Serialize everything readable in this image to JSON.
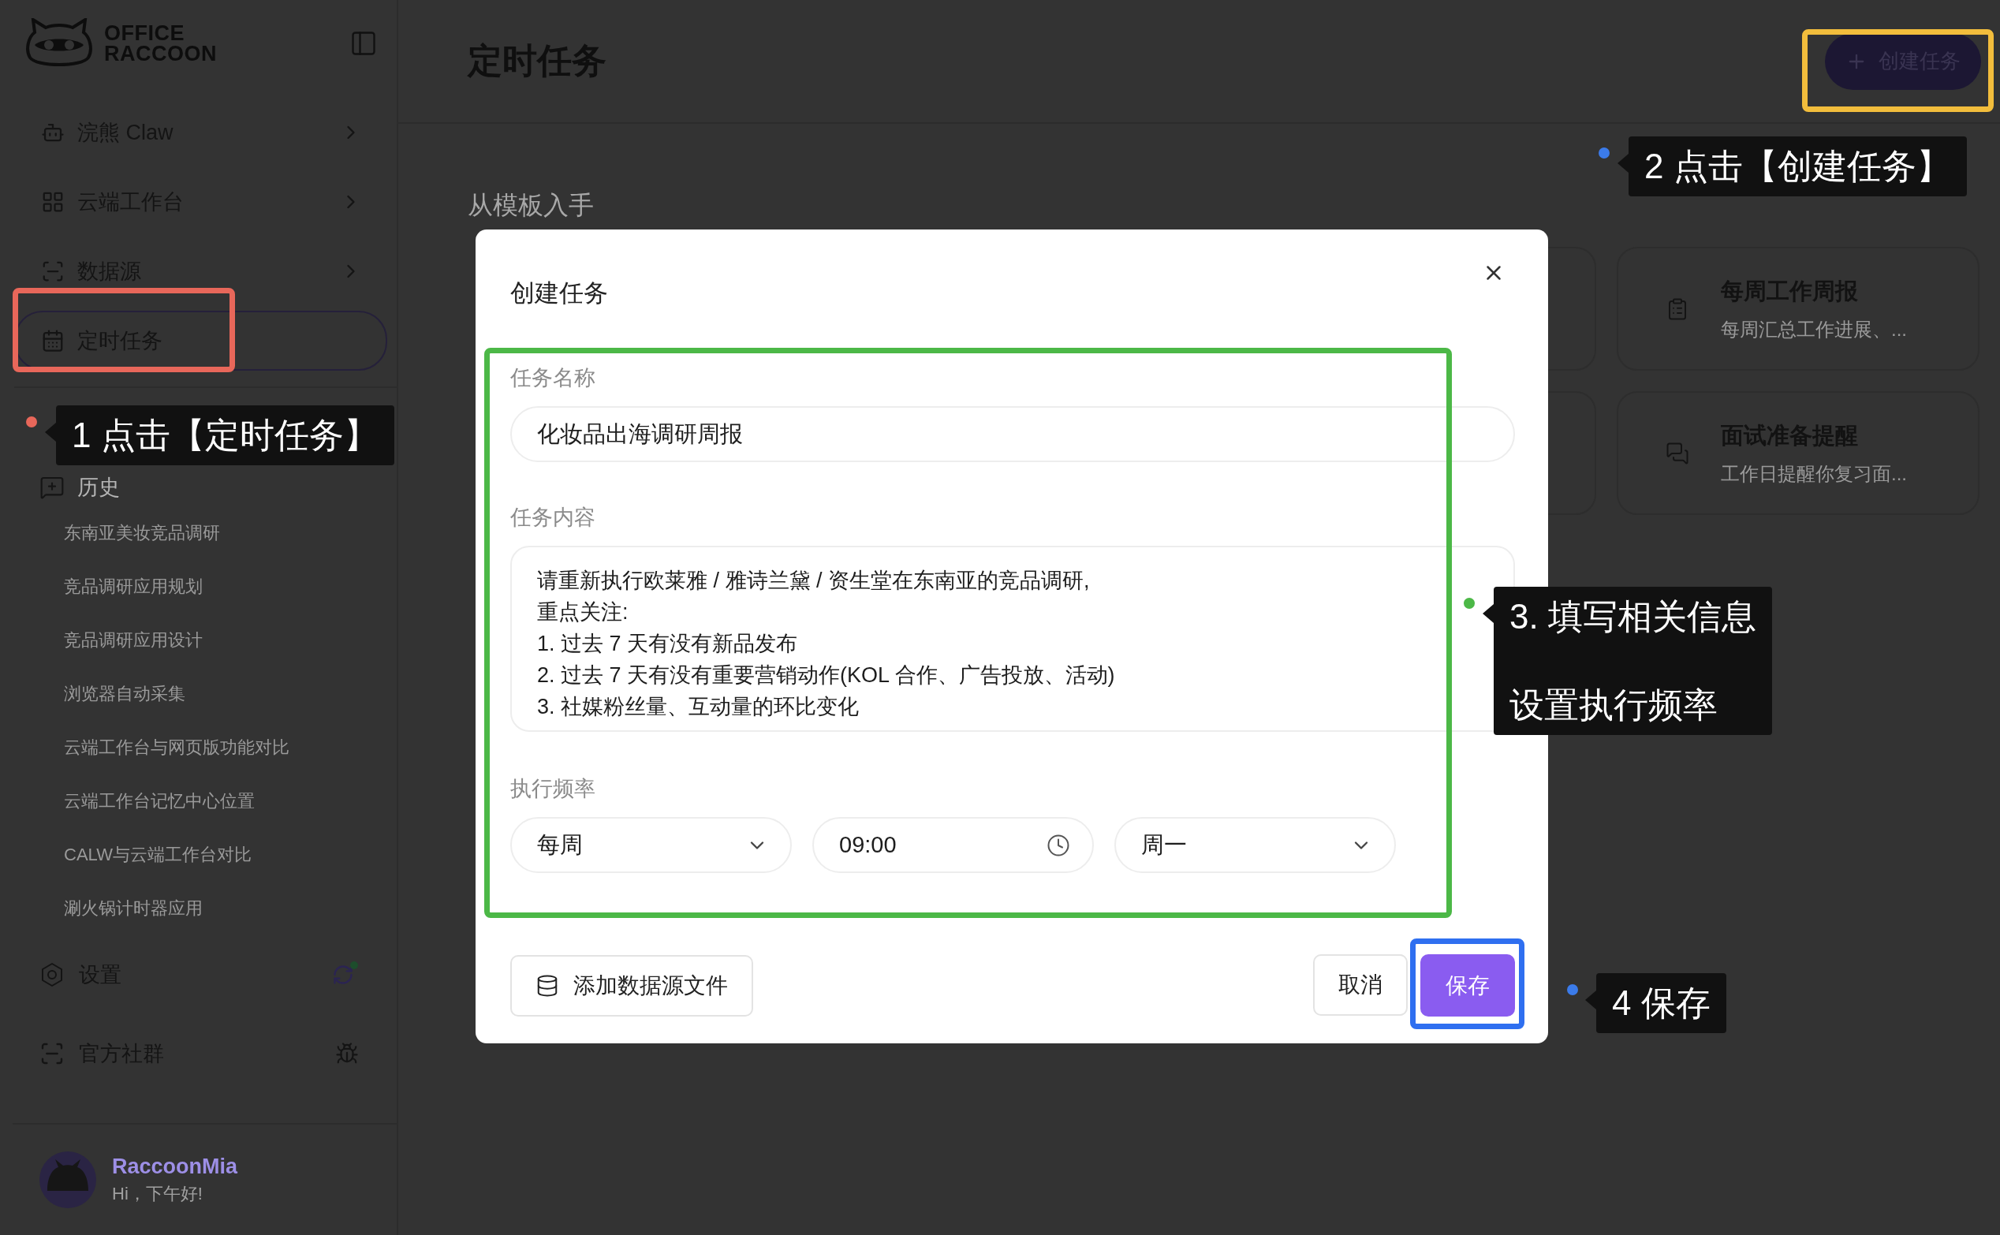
{
  "sidebar": {
    "brand": [
      "OFFICE",
      "RACCOON"
    ],
    "nav": [
      {
        "label": "浣熊 Claw",
        "kind": "robot",
        "expandable": true,
        "selected": false
      },
      {
        "label": "云端工作台",
        "kind": "grid",
        "expandable": true,
        "selected": false
      },
      {
        "label": "数据源",
        "kind": "data",
        "expandable": true,
        "selected": false
      },
      {
        "label": "定时任务",
        "kind": "calendar",
        "expandable": false,
        "selected": true
      }
    ],
    "history": {
      "title": "历史",
      "items": [
        "东南亚美妆竞品调研",
        "竞品调研应用规划",
        "竞品调研应用设计",
        "浏览器自动采集",
        "云端工作台与网页版功能对比",
        "云端工作台记忆中心位置",
        "CALW与云端工作台对比",
        "涮火锅计时器应用"
      ]
    },
    "footer": [
      {
        "label": "设置",
        "kind": "settings"
      },
      {
        "label": "官方社群",
        "kind": "community"
      }
    ],
    "user": {
      "name": "RaccoonMia",
      "greeting": "Hi，下午好!"
    }
  },
  "header": {
    "title": "定时任务",
    "create_button": "创建任务"
  },
  "templates": {
    "title": "从模板入手",
    "cards": [
      {
        "title": "每周工作周报",
        "description": "每周汇总工作进展、...",
        "kind": "clipboard"
      },
      {
        "title": "面试准备提醒",
        "description": "工作日提醒你复习面...",
        "kind": "chat"
      }
    ]
  },
  "dialog": {
    "title": "创建任务",
    "name_label": "任务名称",
    "name_value": "化妆品出海调研周报",
    "content_label": "任务内容",
    "content_value": "请重新执行欧莱雅 / 雅诗兰黛 / 资生堂在东南亚的竞品调研,\n重点关注:\n1. 过去 7 天有没有新品发布\n2. 过去 7 天有没有重要营销动作(KOL 合作、广告投放、活动)\n3. 社媒粉丝量、互动量的环比变化",
    "frequency_label": "执行频率",
    "frequency": "每周",
    "time": "09:00",
    "weekday": "周一",
    "add_source_button": "添加数据源文件",
    "cancel_button": "取消",
    "save_button": "保存"
  },
  "annotations": [
    {
      "kind": "callout",
      "lines": [
        "1 点击【定时任务】"
      ],
      "color": "#e8675a"
    },
    {
      "kind": "callout",
      "lines": [
        "2 点击【创建任务】"
      ],
      "color": "#3b7bea"
    },
    {
      "kind": "callout",
      "lines": [
        "3. 填写相关信息",
        "设置执行频率"
      ],
      "color": "#4cb847"
    },
    {
      "kind": "callout",
      "lines": [
        "4 保存"
      ],
      "color": "#3b7bea"
    },
    {
      "kind": "highlight",
      "color": "#e8675a"
    },
    {
      "kind": "highlight",
      "color": "#f2bd3c"
    },
    {
      "kind": "highlight",
      "color": "#4cb847"
    },
    {
      "kind": "highlight",
      "color": "#2f6ff0"
    }
  ]
}
